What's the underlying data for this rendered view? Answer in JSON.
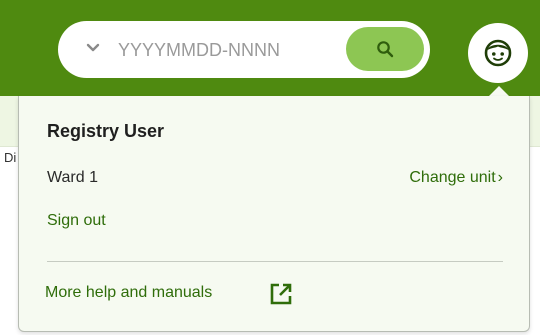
{
  "search": {
    "placeholder": "YYYYMMDD-NNNN",
    "dropdown_icon": "chevron-down-icon",
    "button_icon": "search-icon"
  },
  "subbar": {
    "edge_text": "Di"
  },
  "user_menu": {
    "avatar_icon": "user-avatar-icon",
    "user_name": "Registry User",
    "unit": "Ward 1",
    "change_unit_label": "Change unit",
    "sign_out_label": "Sign out",
    "help_label": "More help and manuals",
    "help_icon": "external-link-icon"
  },
  "colors": {
    "header": "#4f8a10",
    "search_button": "#8dc653",
    "link": "#2f6d0a",
    "panel": "#f6faf1"
  }
}
